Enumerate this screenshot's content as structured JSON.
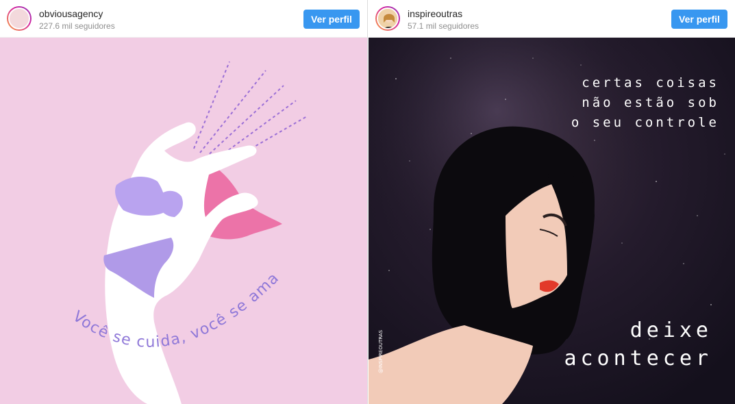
{
  "posts": [
    {
      "username": "obviousagency",
      "followers": "227.6 mil seguidores",
      "follow_label": "Ver perfil",
      "image": {
        "caption": "Você se cuida, você se ama",
        "background": "#f2cde4",
        "accent": "#9b6fd6"
      }
    },
    {
      "username": "inspireoutras",
      "followers": "57.1 mil seguidores",
      "follow_label": "Ver perfil",
      "image": {
        "quote_lines": [
          "certas coisas",
          "não estão sob",
          "o seu controle"
        ],
        "headline_lines": [
          "deixe",
          "acontecer"
        ],
        "watermark": "@INSPIREOUTRAS",
        "background": "#1a1520"
      }
    }
  ],
  "colors": {
    "button": "#3897f0",
    "username": "#262626",
    "muted": "#8e8e8e"
  }
}
